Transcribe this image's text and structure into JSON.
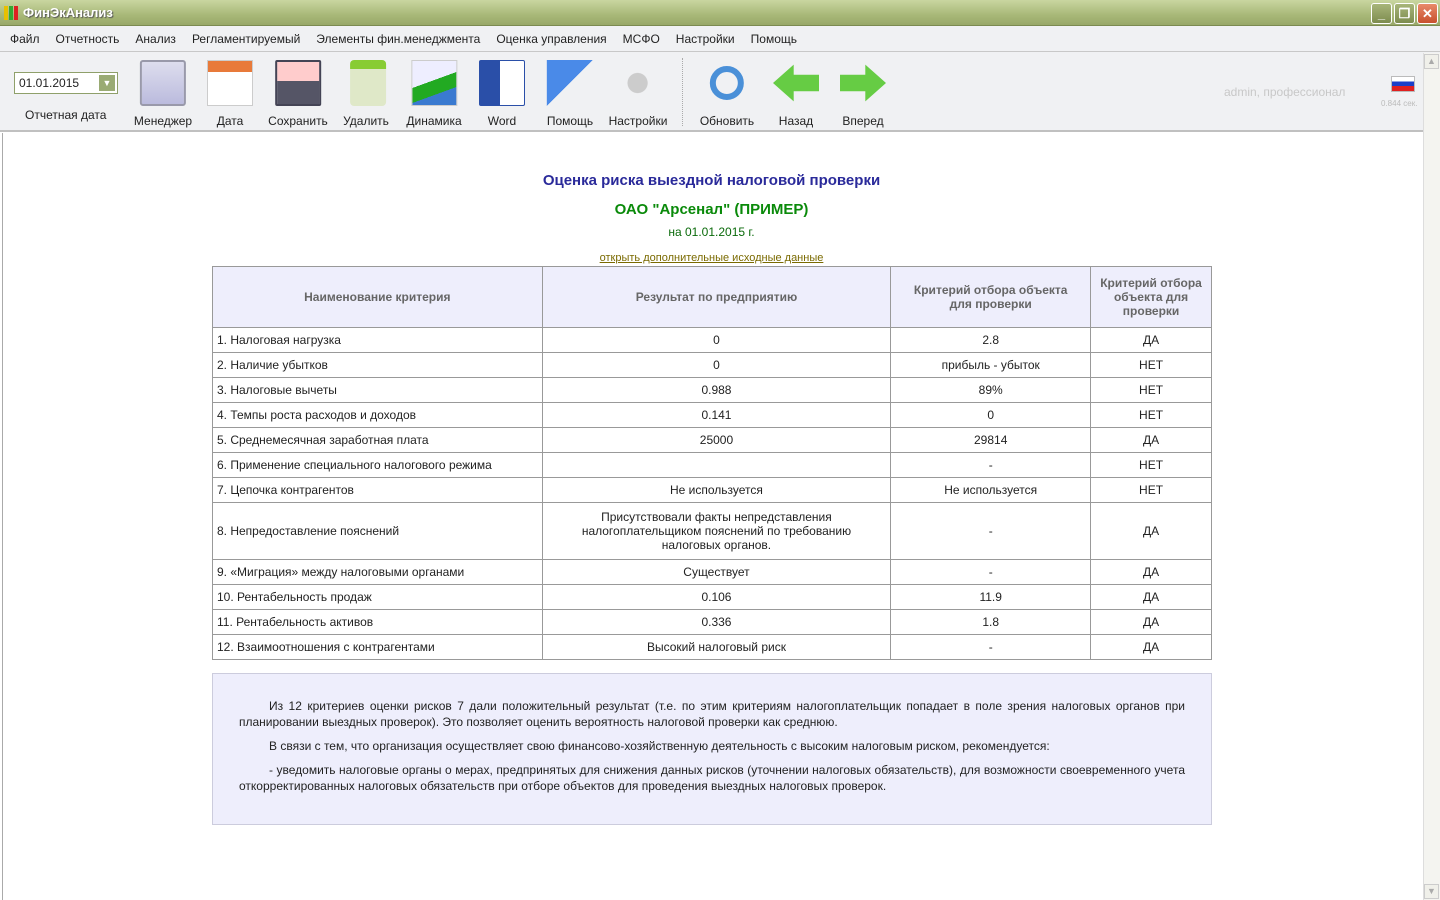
{
  "window": {
    "title": "ФинЭкАнализ"
  },
  "menu": [
    "Файл",
    "Отчетность",
    "Анализ",
    "Регламентируемый",
    "Элементы фин.менеджмента",
    "Оценка управления",
    "МСФО",
    "Настройки",
    "Помощь"
  ],
  "toolbar": {
    "date_value": "01.01.2015",
    "date_label": "Отчетная дата",
    "buttons": [
      {
        "label": "Менеджер",
        "icon": "manager-icon"
      },
      {
        "label": "Дата",
        "icon": "calendar-icon"
      },
      {
        "label": "Сохранить",
        "icon": "floppy-icon"
      },
      {
        "label": "Удалить",
        "icon": "recycle-bin-icon"
      },
      {
        "label": "Динамика",
        "icon": "chart-icon"
      },
      {
        "label": "Word",
        "icon": "word-icon"
      },
      {
        "label": "Помощь",
        "icon": "flag-icon"
      },
      {
        "label": "Настройки",
        "icon": "tools-icon"
      },
      {
        "label": "Обновить",
        "icon": "refresh-icon"
      },
      {
        "label": "Назад",
        "icon": "arrow-left-icon"
      },
      {
        "label": "Вперед",
        "icon": "arrow-right-icon"
      }
    ],
    "user": "admin, профессионал",
    "timing": "0.844 сек."
  },
  "report": {
    "title": "Оценка риска выездной налоговой проверки",
    "company": "ОАО \"Арсенал\" (ПРИМЕР)",
    "date": "на 01.01.2015 г.",
    "link": "открыть дополнительные исходные данные",
    "headers": [
      "Наименование критерия",
      "Результат по предприятию",
      "Критерий отбора объекта для проверки",
      "Критерий отбора объекта для проверки"
    ],
    "rows": [
      [
        "1. Налоговая нагрузка",
        "0",
        "2.8",
        "ДА"
      ],
      [
        "2. Наличие убытков",
        "0",
        "прибыль - убыток",
        "НЕТ"
      ],
      [
        "3. Налоговые вычеты",
        "0.988",
        "89%",
        "НЕТ"
      ],
      [
        "4. Темпы роста расходов и доходов",
        "0.141",
        "0",
        "НЕТ"
      ],
      [
        "5. Среднемесячная заработная плата",
        "25000",
        "29814",
        "ДА"
      ],
      [
        "6. Применение специального налогового режима",
        "",
        "-",
        "НЕТ"
      ],
      [
        "7. Цепочка контрагентов",
        "Не используется",
        "Не используется",
        "НЕТ"
      ],
      [
        "8. Непредоставление пояснений",
        "Присутствовали факты непредставления налогоплательщиком пояснений по требованию налоговых органов.",
        "-",
        "ДА"
      ],
      [
        "9. «Миграция» между налоговыми органами",
        "Существует",
        "-",
        "ДА"
      ],
      [
        "10. Рентабельность продаж",
        "0.106",
        "11.9",
        "ДА"
      ],
      [
        "11. Рентабельность активов",
        "0.336",
        "1.8",
        "ДА"
      ],
      [
        "12. Взаимоотношения с контрагентами",
        "Высокий налоговый риск",
        "-",
        "ДА"
      ]
    ],
    "conclusion": [
      "Из 12 критериев оценки рисков 7 дали положительный результат (т.е. по этим критериям налогоплательщик попадает в поле зрения налоговых органов при планировании выездных проверок). Это позволяет оценить вероятность налоговой проверки как среднюю.",
      "В связи с тем, что организация осуществляет свою финансово-хозяйственную деятельность с высоким налоговым риском, рекомендуется:",
      "- уведомить налоговые органы о мерах, предпринятых для снижения данных рисков (уточнении налоговых обязательств), для возможности своевременного учета откорректированных налоговых обязательств при отборе объектов для проведения выездных налоговых проверок."
    ]
  }
}
